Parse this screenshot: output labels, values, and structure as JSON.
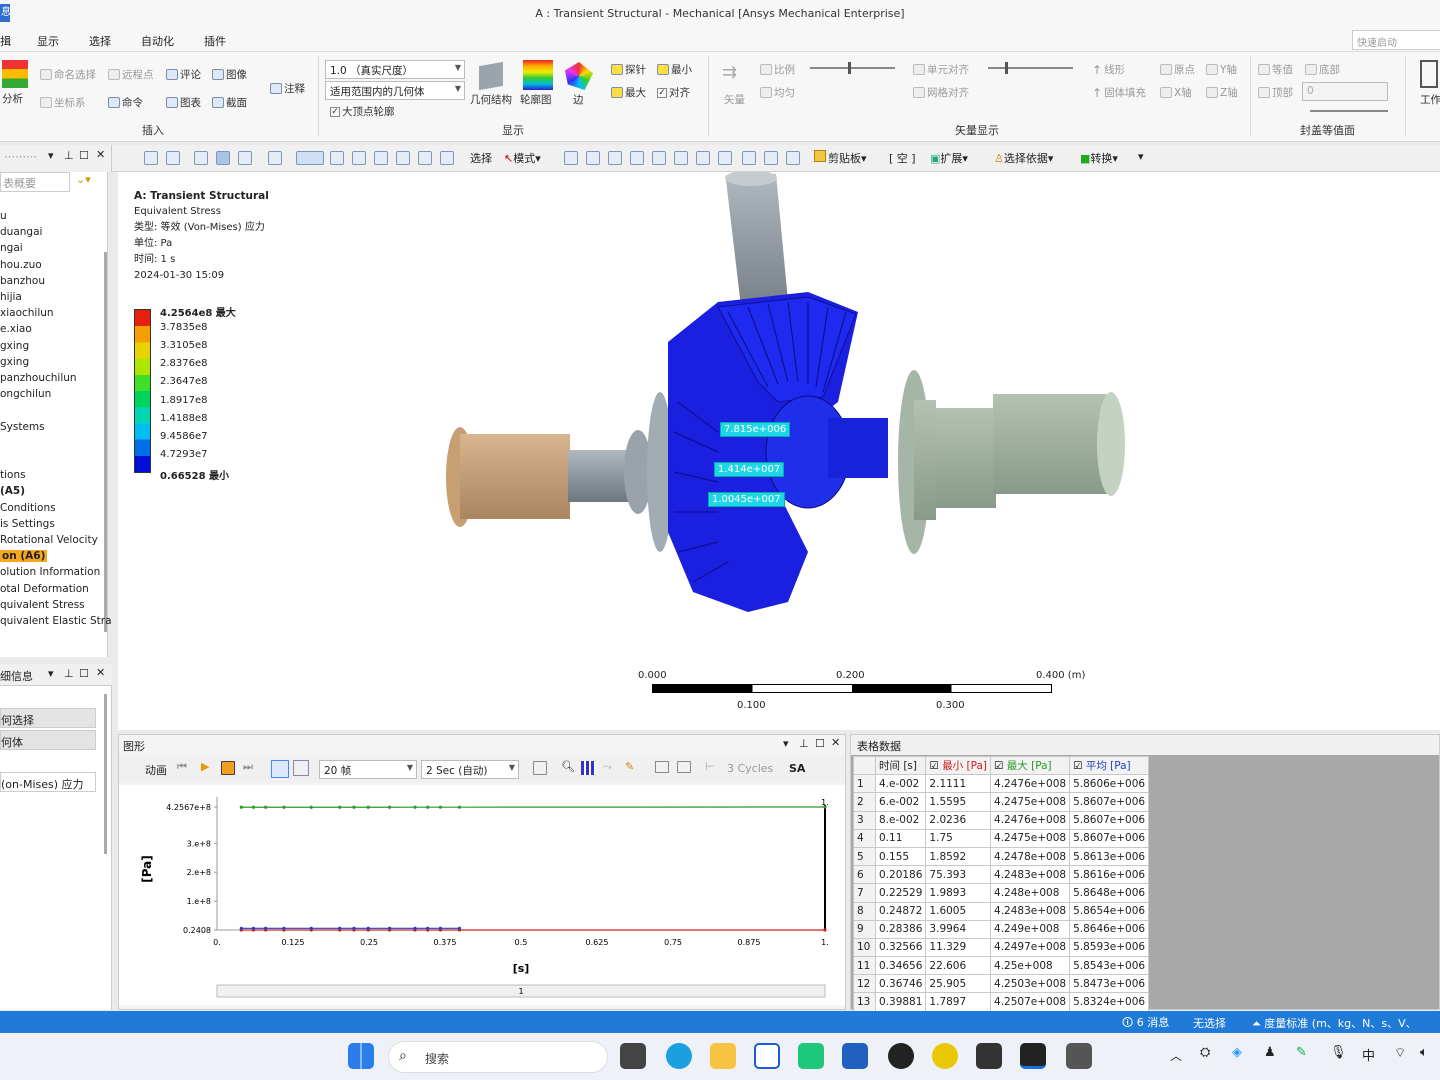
{
  "title": "A : Transient Structural - Mechanical [Ansys Mechanical Enterprise]",
  "app_icon_text": "息",
  "menu": [
    "揖",
    "显示",
    "选择",
    "自动化",
    "插件"
  ],
  "quick_launch": "快速启动",
  "ribbon": {
    "analysis": "分析",
    "named_sel": "命名选择",
    "remote_pt": "远程点",
    "comment": "评论",
    "image": "图像",
    "coord": "坐标系",
    "command": "命令",
    "chart": "图表",
    "section": "截面",
    "annot": "注释",
    "scale_value": "1.0 （真实尺度）",
    "geom_scope": "适用范围内的几何体",
    "big_vertex": "大顶点轮廓",
    "geometry": "几何结构",
    "contour": "轮廓图",
    "edge": "边",
    "probe": "探针",
    "min": "最小",
    "max": "最大",
    "align": "对齐",
    "vector": "矢量",
    "proportional": "比例",
    "uniform": "均匀",
    "elem_align": "单元对齐",
    "grid_align": "网格对齐",
    "line": "线形",
    "solid_fill": "固体填充",
    "origin": "原点",
    "x_axis": "X轴",
    "y_axis": "Y轴",
    "z_axis": "Z轴",
    "isovalue": "等值",
    "bottom": "底部",
    "top": "顶部",
    "cap_value": "0",
    "work": "工作",
    "grp_insert": "插入",
    "grp_display": "显示",
    "grp_vector": "矢量显示",
    "grp_cap": "封盖等值面"
  },
  "toolbar": {
    "select": "选择",
    "mode": "模式",
    "clipboard": "剪贴板",
    "empty": "[ 空 ]",
    "extend": "扩展",
    "select_by": "选择依据",
    "convert": "转换"
  },
  "tree": {
    "search_placeholder": "表概要",
    "items": [
      "u",
      "duangai",
      "ngai",
      "hou.zuo",
      "banzhou",
      "hijia",
      "xiaochilun",
      "e.xiao",
      "gxing",
      "gxing",
      "panzhouchilun",
      "ongchilun",
      "",
      "Systems",
      "",
      "",
      "tions",
      "(A5)",
      "Conditions",
      "is Settings",
      "Rotational Velocity",
      "on (A6)",
      "olution Information",
      "otal Deformation",
      "quivalent Stress",
      "quivalent Elastic Stra"
    ]
  },
  "details": {
    "header": "细信息",
    "rows": [
      "何选择",
      "何体",
      "",
      "(on-Mises) 应力"
    ]
  },
  "viewport": {
    "legend_title": "A: Transient Structural",
    "legend_type": "Equivalent Stress",
    "legend_kind": "类型: 等效 (Von-Mises) 应力",
    "legend_unit": "单位: Pa",
    "legend_time": "时间: 1 s",
    "legend_date": "2024-01-30 15:09",
    "legend_values": [
      "4.2564e8 最大",
      "3.7835e8",
      "3.3105e8",
      "2.8376e8",
      "2.3647e8",
      "1.8917e8",
      "1.4188e8",
      "9.4586e7",
      "4.7293e7",
      "0.66528 最小"
    ],
    "legend_colors": [
      "#e81e0e",
      "#f5a000",
      "#e8d200",
      "#aee600",
      "#3ee02a",
      "#00d45a",
      "#00d6b4",
      "#00bff0",
      "#0070e8",
      "#0010d8"
    ],
    "probes": [
      "7.815e+006",
      "1.414e+007",
      "1.0045e+007"
    ],
    "scale_top": [
      "0.000",
      "0.200",
      "0.400 (m)"
    ],
    "scale_bottom": [
      "0.100",
      "0.300"
    ]
  },
  "graph": {
    "header": "图形",
    "animation": "动画",
    "frames": "20 帧",
    "duration": "2 Sec (自动)",
    "cycles": "3 Cycles",
    "sa": "SA",
    "ylabel": "[Pa]",
    "xlabel": "[s]",
    "y_ticks": [
      "4.2567e+8",
      "3.e+8",
      "2.e+8",
      "1.e+8",
      "0.2408"
    ],
    "x_ticks": [
      "0.",
      "0.125",
      "0.25",
      "0.375",
      "0.5",
      "0.625",
      "0.75",
      "0.875",
      "1."
    ],
    "end_marker": "1.",
    "slider": "1"
  },
  "table": {
    "header": "表格数据",
    "columns": [
      "时间 [s]",
      "最小 [Pa]",
      "最大 [Pa]",
      "平均 [Pa]"
    ],
    "rows": [
      [
        "1",
        "4.e-002",
        "2.1111",
        "4.2476e+008",
        "5.8606e+006"
      ],
      [
        "2",
        "6.e-002",
        "1.5595",
        "4.2475e+008",
        "5.8607e+006"
      ],
      [
        "3",
        "8.e-002",
        "2.0236",
        "4.2476e+008",
        "5.8607e+006"
      ],
      [
        "4",
        "0.11",
        "1.75",
        "4.2475e+008",
        "5.8607e+006"
      ],
      [
        "5",
        "0.155",
        "1.8592",
        "4.2478e+008",
        "5.8613e+006"
      ],
      [
        "6",
        "0.20186",
        "75.393",
        "4.2483e+008",
        "5.8616e+006"
      ],
      [
        "7",
        "0.22529",
        "1.9893",
        "4.248e+008",
        "5.8648e+006"
      ],
      [
        "8",
        "0.24872",
        "1.6005",
        "4.2483e+008",
        "5.8654e+006"
      ],
      [
        "9",
        "0.28386",
        "3.9964",
        "4.249e+008",
        "5.8646e+006"
      ],
      [
        "10",
        "0.32566",
        "11.329",
        "4.2497e+008",
        "5.8593e+006"
      ],
      [
        "11",
        "0.34656",
        "22.606",
        "4.25e+008",
        "5.8543e+006"
      ],
      [
        "12",
        "0.36746",
        "25.905",
        "4.2503e+008",
        "5.8473e+006"
      ],
      [
        "13",
        "0.39881",
        "1.7897",
        "4.2507e+008",
        "5.8324e+006"
      ]
    ]
  },
  "chart_data": {
    "type": "line",
    "xlabel": "[s]",
    "ylabel": "[Pa]",
    "xlim": [
      0,
      1
    ],
    "ylim": [
      0.2408,
      425670000
    ],
    "series": [
      {
        "name": "最大 [Pa]",
        "color": "#2a9a2a",
        "x": [
          0.04,
          0.06,
          0.08,
          0.11,
          0.155,
          0.20186,
          0.22529,
          0.24872,
          0.28386,
          0.32566,
          0.34656,
          0.36746,
          0.39881,
          1.0
        ],
        "values": [
          424760000,
          424750000,
          424760000,
          424750000,
          424780000,
          424830000,
          424800000,
          424830000,
          424900000,
          424970000,
          425000000,
          425030000,
          425070000,
          425670000
        ]
      },
      {
        "name": "最小 [Pa]",
        "color": "#d02020",
        "x": [
          0.04,
          0.06,
          0.08,
          0.11,
          0.155,
          0.20186,
          0.22529,
          0.24872,
          0.28386,
          0.32566,
          0.34656,
          0.36746,
          0.39881,
          1.0
        ],
        "values": [
          2.1111,
          1.5595,
          2.0236,
          1.75,
          1.8592,
          75.393,
          1.9893,
          1.6005,
          3.9964,
          11.329,
          22.606,
          25.905,
          1.7897,
          0.66528
        ]
      },
      {
        "name": "平均 [Pa]",
        "color": "#2040c0",
        "x": [
          0.04,
          0.06,
          0.08,
          0.11,
          0.155,
          0.20186,
          0.22529,
          0.24872,
          0.28386,
          0.32566,
          0.34656,
          0.36746,
          0.39881
        ],
        "values": [
          5860600,
          5860700,
          5860700,
          5860700,
          5861300,
          5861600,
          5864800,
          5865400,
          5864600,
          5859300,
          5854300,
          5847300,
          5832400
        ]
      }
    ]
  },
  "status": {
    "messages": "6 消息",
    "no_selection": "无选择",
    "units": "度量标准 (m、kg、N、s、V、"
  },
  "taskbar": {
    "search": "搜索",
    "lang": "中"
  }
}
